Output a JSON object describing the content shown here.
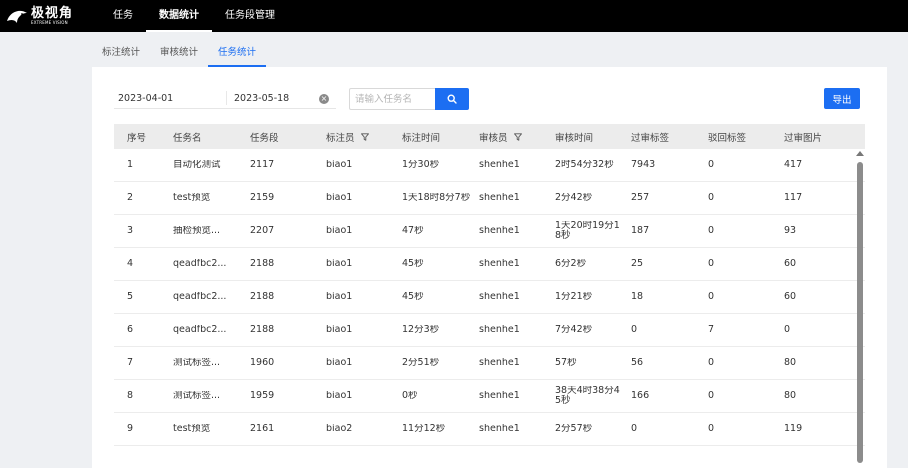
{
  "logo": {
    "cn": "极视角",
    "en": "EXTREME VISION"
  },
  "nav": [
    {
      "label": "任务",
      "active": false
    },
    {
      "label": "数据统计",
      "active": true
    },
    {
      "label": "任务段管理",
      "active": false
    }
  ],
  "tabs": [
    {
      "label": "标注统计",
      "active": false
    },
    {
      "label": "审核统计",
      "active": false
    },
    {
      "label": "任务统计",
      "active": true
    }
  ],
  "filters": {
    "date_start": "2023-04-01",
    "date_end": "2023-05-18",
    "search_placeholder": "请输入任务名",
    "search_value": ""
  },
  "toolbar": {
    "export_label": "导出"
  },
  "table": {
    "columns": [
      "序号",
      "任务名",
      "任务段",
      "标注员",
      "标注时间",
      "审核员",
      "审核时间",
      "过审标签",
      "驳回标签",
      "过审图片"
    ],
    "filter_columns": [
      "标注员",
      "审核员"
    ],
    "rows": [
      [
        "1",
        "自动化测试",
        "2117",
        "biao1",
        "1分30秒",
        "shenhe1",
        "2时54分32秒",
        "7943",
        "0",
        "417"
      ],
      [
        "2",
        "test预览",
        "2159",
        "biao1",
        "1天18时8分7秒",
        "shenhe1",
        "2分42秒",
        "257",
        "0",
        "117"
      ],
      [
        "3",
        "抽检预览...",
        "2207",
        "biao1",
        "47秒",
        "shenhe1",
        "1天20时19分18秒",
        "187",
        "0",
        "93"
      ],
      [
        "4",
        "qeadfbc2...",
        "2188",
        "biao1",
        "45秒",
        "shenhe1",
        "6分2秒",
        "25",
        "0",
        "60"
      ],
      [
        "5",
        "qeadfbc2...",
        "2188",
        "biao1",
        "45秒",
        "shenhe1",
        "1分21秒",
        "18",
        "0",
        "60"
      ],
      [
        "6",
        "qeadfbc2...",
        "2188",
        "biao1",
        "12分3秒",
        "shenhe1",
        "7分42秒",
        "0",
        "7",
        "0"
      ],
      [
        "7",
        "测试标签...",
        "1960",
        "biao1",
        "2分51秒",
        "shenhe1",
        "57秒",
        "56",
        "0",
        "80"
      ],
      [
        "8",
        "测试标签...",
        "1959",
        "biao1",
        "0秒",
        "shenhe1",
        "38天4时38分45秒",
        "166",
        "0",
        "80"
      ],
      [
        "9",
        "test预览",
        "2161",
        "biao2",
        "11分12秒",
        "shenhe1",
        "2分57秒",
        "0",
        "0",
        "119"
      ]
    ]
  },
  "colors": {
    "accent": "#1c6ef2",
    "topbar": "#000000",
    "header_bg": "#ececec"
  },
  "icons": {
    "search": "search-icon",
    "clear": "clear-icon",
    "filter": "filter-icon",
    "logo": "logo-icon"
  }
}
